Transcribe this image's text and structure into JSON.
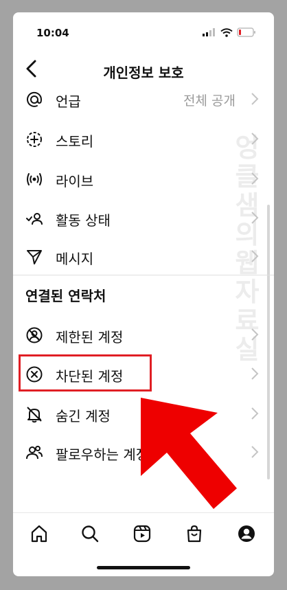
{
  "status_bar": {
    "time": "10:04"
  },
  "header": {
    "title": "개인정보 보호"
  },
  "rows": [
    {
      "label": "언급",
      "value": "전체 공개",
      "icon": "at-sign-icon"
    },
    {
      "label": "스토리",
      "icon": "story-add-icon"
    },
    {
      "label": "라이브",
      "icon": "live-broadcast-icon"
    },
    {
      "label": "활동 상태",
      "icon": "activity-status-icon"
    },
    {
      "label": "메시지",
      "icon": "paper-plane-icon"
    }
  ],
  "section": {
    "title": "연결된 연락처"
  },
  "contact_rows": [
    {
      "label": "제한된 계정",
      "icon": "restricted-account-icon"
    },
    {
      "label": "차단된 계정",
      "icon": "blocked-circle-x-icon"
    },
    {
      "label": "숨긴 계정",
      "icon": "muted-bell-icon"
    },
    {
      "label": "팔로우하는 계정",
      "icon": "people-icon"
    }
  ],
  "watermark": {
    "text": "엉클샘의웹자료실"
  },
  "tabbar": {
    "icons": [
      "home-icon",
      "search-icon",
      "reels-icon",
      "shop-icon",
      "profile-icon"
    ]
  },
  "colors": {
    "highlight": "#e01e24",
    "arrow": "#ee0000",
    "text": "#111111",
    "muted": "#9a9a9a"
  }
}
